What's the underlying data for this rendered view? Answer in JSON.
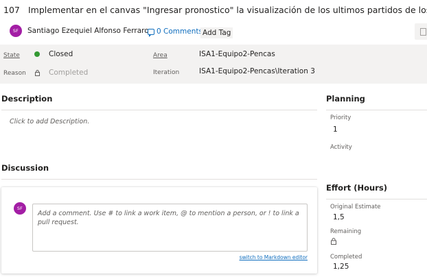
{
  "header": {
    "id": "107",
    "title": "Implementar en el canvas \"Ingresar pronostico\" la visualización de los ultimos partidos de los equipos",
    "assignee_initials": "SF",
    "assignee_name": "Santiago Ezequiel Alfonso Ferraro",
    "comments_label": "0 Comments",
    "add_tag_label": "Add Tag"
  },
  "fields": {
    "state_label": "State",
    "state_value": "Closed",
    "reason_label": "Reason",
    "reason_value": "Completed",
    "area_label": "Area",
    "area_value": "ISA1-Equipo2-Pencas",
    "iteration_label": "Iteration",
    "iteration_value": "ISA1-Equipo2-Pencas\\Iteration 3"
  },
  "description": {
    "title": "Description",
    "placeholder": "Click to add Description."
  },
  "discussion": {
    "title": "Discussion",
    "avatar_initials": "SF",
    "comment_placeholder": "Add a comment. Use # to link a work item, @ to mention a person, or ! to link a pull request.",
    "markdown_link": "switch to Markdown editor"
  },
  "planning": {
    "title": "Planning",
    "priority_label": "Priority",
    "priority_value": "1",
    "activity_label": "Activity"
  },
  "effort": {
    "title": "Effort (Hours)",
    "original_estimate_label": "Original Estimate",
    "original_estimate_value": "1,5",
    "remaining_label": "Remaining",
    "completed_label": "Completed",
    "completed_value": "1,25"
  },
  "colors": {
    "state_closed": "#339933",
    "avatar": "#a31ea5",
    "link": "#106ebe",
    "band": "#f3f2f1"
  },
  "icons": [
    "comment-icon",
    "state-dot-icon",
    "lock-icon",
    "side-panel-icon"
  ]
}
